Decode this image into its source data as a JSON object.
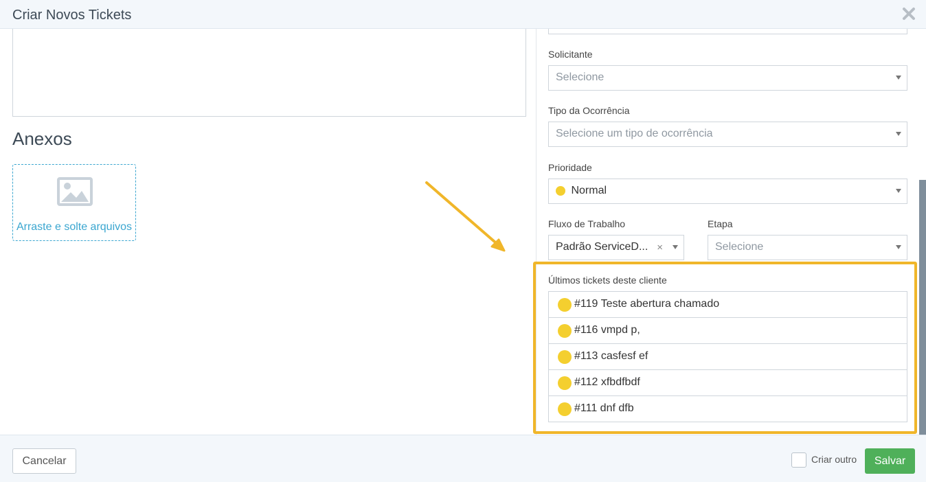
{
  "modal": {
    "title": "Criar Novos Tickets"
  },
  "attachments": {
    "title": "Anexos",
    "dropzone_label": "Arraste e solte arquivos"
  },
  "form": {
    "solicitante": {
      "label": "Solicitante",
      "placeholder": "Selecione"
    },
    "tipo_ocorrencia": {
      "label": "Tipo da Ocorrência",
      "placeholder": "Selecione um tipo de ocorrência"
    },
    "prioridade": {
      "label": "Prioridade",
      "value": "Normal",
      "color": "#f4cf2f"
    },
    "fluxo_trabalho": {
      "label": "Fluxo de Trabalho",
      "value": "Padrão ServiceD...",
      "clear_icon": "×"
    },
    "etapa": {
      "label": "Etapa",
      "placeholder": "Selecione"
    }
  },
  "recent_tickets": {
    "label": "Últimos tickets deste cliente",
    "highlight_color": "#f0b62a",
    "items": [
      {
        "text": "#119 Teste abertura chamado"
      },
      {
        "text": "#116 vmpd p,"
      },
      {
        "text": "#113 casfesf ef"
      },
      {
        "text": "#112 xfbdfbdf"
      },
      {
        "text": "#111 dnf dfb"
      }
    ]
  },
  "footer": {
    "cancel_label": "Cancelar",
    "create_another_label": "Criar outro",
    "save_label": "Salvar",
    "save_color": "#4fb05a"
  }
}
